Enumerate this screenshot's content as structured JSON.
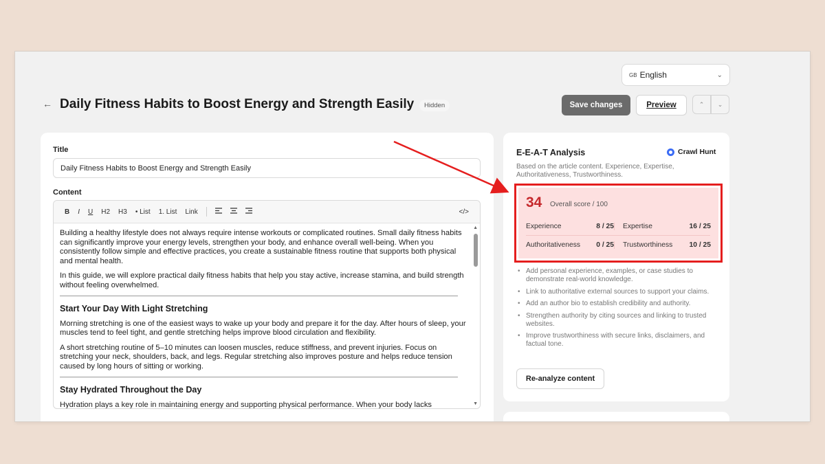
{
  "header": {
    "language": {
      "flag": "GB",
      "label": "English"
    },
    "title": "Daily Fitness Habits to Boost Energy and Strength Easily",
    "visibility_badge": "Hidden",
    "save_label": "Save changes",
    "preview_label": "Preview",
    "icons": [
      "arrow-left-icon",
      "chevron-up-icon",
      "chevron-down-icon"
    ]
  },
  "editor": {
    "title_label": "Title",
    "title_value": "Daily Fitness Habits to Boost Energy and Strength Easily",
    "content_label": "Content",
    "toolbar": [
      "B",
      "I",
      "U",
      "H2",
      "H3",
      "• List",
      "1. List",
      "Link",
      "</>"
    ],
    "paragraphs": [
      "Building a healthy lifestyle does not always require intense workouts or complicated routines. Small daily fitness habits can significantly improve your energy levels, strengthen your body, and enhance overall well-being. When you consistently follow simple and effective practices, you create a sustainable fitness routine that supports both physical and mental health.",
      "In this guide, we will explore practical daily fitness habits that help you stay active, increase stamina, and build strength without feeling overwhelmed."
    ],
    "sections": [
      {
        "heading": "Start Your Day With Light Stretching",
        "paragraphs": [
          "Morning stretching is one of the easiest ways to wake up your body and prepare it for the day. After hours of sleep, your muscles tend to feel tight, and gentle stretching helps improve blood circulation and flexibility.",
          "A short stretching routine of 5–10 minutes can loosen muscles, reduce stiffness, and prevent injuries. Focus on stretching your neck, shoulders, back, and legs. Regular stretching also improves posture and helps reduce tension caused by long hours of sitting or working."
        ]
      },
      {
        "heading": "Stay Hydrated Throughout the Day",
        "paragraphs": [
          "Hydration plays a key role in maintaining energy and supporting physical performance. When your body lacks"
        ]
      }
    ]
  },
  "eeat": {
    "title": "E-E-A-T Analysis",
    "brand": "Crawl Hunt",
    "description": "Based on the article content. Experience, Expertise, Authoritativeness, Trustworthiness.",
    "score": "34",
    "score_caption": "Overall score / 100",
    "metrics": [
      {
        "name": "Experience",
        "value": "8 / 25"
      },
      {
        "name": "Expertise",
        "value": "16 / 25"
      },
      {
        "name": "Authoritativeness",
        "value": "0 / 25"
      },
      {
        "name": "Trustworthiness",
        "value": "10 / 25"
      }
    ],
    "tips": [
      "Add personal experience, examples, or case studies to demonstrate real-world knowledge.",
      "Link to authoritative external sources to support your claims.",
      "Add an author bio to establish credibility and authority.",
      "Strengthen authority by citing sources and linking to trusted websites.",
      "Improve trustworthiness with secure links, disclaimers, and factual tone."
    ],
    "reanalyze_label": "Re-analyze content",
    "highlight_color": "#e51e1e",
    "score_color": "#c5282c"
  }
}
